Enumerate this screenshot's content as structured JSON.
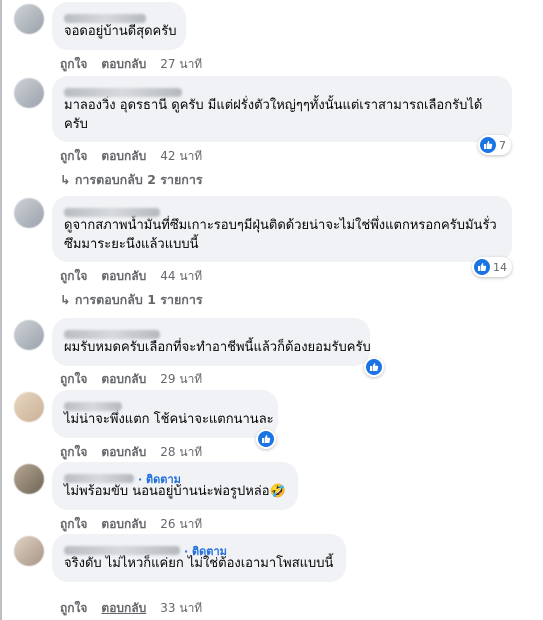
{
  "comments": [
    {
      "text": [
        "จอดอยู่บ้านดีสุดครับ"
      ],
      "like": "ถูกใจ",
      "reply": "ตอบกลับ",
      "time": "27 นาที"
    },
    {
      "text": [
        "มาลองวิ่ง อุดรธานี ดูครับ มีแต่ฝรั่งตัวใหญ่ๆๆทั้งนั้นแต่เราสามารถเลือกรับได้",
        "ครับ"
      ],
      "like": "ถูกใจ",
      "reply": "ตอบกลับ",
      "time": "42 นาที",
      "reactions": "7",
      "replies": "↳ การตอบกลับ 2 รายการ"
    },
    {
      "text": [
        "ดูจากสภาพน้ำมันที่ซึมเกาะรอบๆมีฝุ่นติดด้วยน่าจะไม่ใช่พึ่งแตกหรอกครับมันรั่ว",
        "ซึมมาระยะนึงแล้วแบบนี้"
      ],
      "like": "ถูกใจ",
      "reply": "ตอบกลับ",
      "time": "44 นาที",
      "reactions": "14",
      "replies": "↳ การตอบกลับ 1 รายการ"
    },
    {
      "text": [
        "ผมรับหมดครับเลือกที่จะทำอาชีพนี้แล้วก็ต้องยอมรับครับ"
      ],
      "like": "ถูกใจ",
      "reply": "ตอบกลับ",
      "time": "29 นาที"
    },
    {
      "text": [
        "ไม่น่าจะพึ่งแตก โช้คน่าจะแตกนานละ"
      ],
      "like": "ถูกใจ",
      "reply": "ตอบกลับ",
      "time": "28 นาที"
    },
    {
      "follow": "· ติดตาม",
      "text": [
        "ไม่พร้อมขับ นอนอยู่บ้านน่ะพ่อรูปหล่อ🤣"
      ],
      "like": "ถูกใจ",
      "reply": "ตอบกลับ",
      "time": "26 นาที"
    },
    {
      "follow": "· ติดตาม",
      "text": [
        "จริงดับ ไม่ไหวก็แค่ยก ไม่ใช่ต้องเอามาโพสแบบนี้"
      ],
      "like": "ถูกใจ",
      "reply": "ตอบกลับ",
      "time": "33 นาที"
    }
  ]
}
